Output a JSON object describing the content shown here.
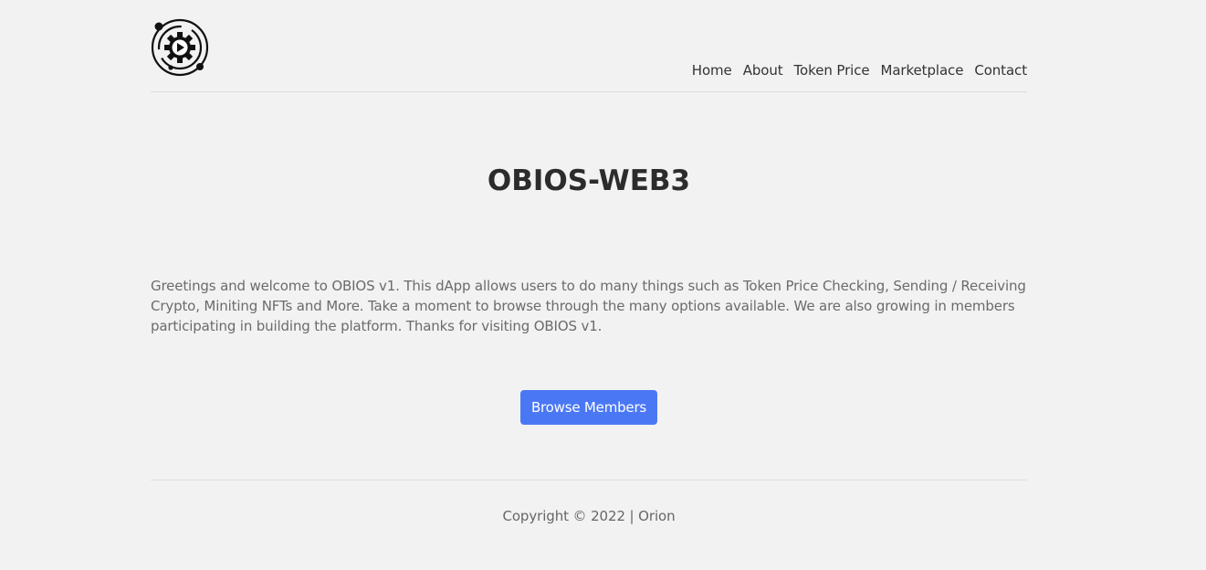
{
  "header": {
    "logo_icon": "orbit-gear-play-logo",
    "nav": {
      "home": "Home",
      "about": "About",
      "token_price": "Token Price",
      "marketplace": "Marketplace",
      "contact": "Contact"
    }
  },
  "main": {
    "title": "OBIOS-WEB3",
    "intro": "Greetings and welcome to OBIOS v1. This dApp allows users to do many things such as Token Price Checking, Sending / Receiving Crypto, Miniting NFTs and More. Take a moment to browse through the many options available. We are also growing in members participating in building the platform. Thanks for visiting OBIOS v1.",
    "button_label": "Browse Members"
  },
  "footer": {
    "copyright": "Copyright © 2022 | Orion"
  },
  "colors": {
    "background": "#f2f2f2",
    "button": "#4a78f5",
    "text": "#333333"
  }
}
